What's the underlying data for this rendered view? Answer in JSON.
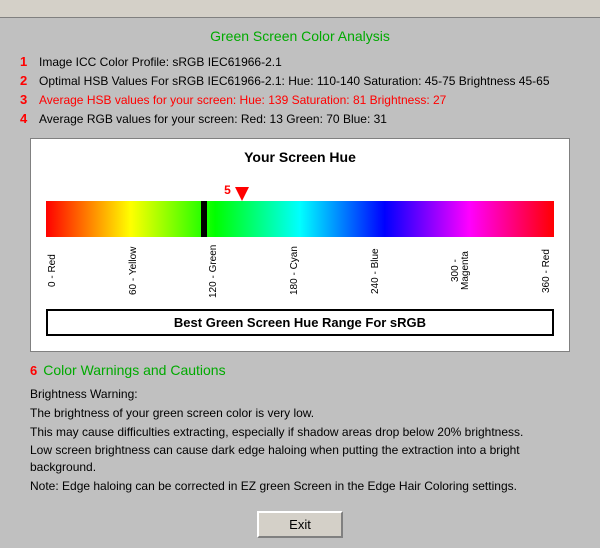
{
  "topBar": {},
  "title": "Green Screen Color Analysis",
  "infoRows": [
    {
      "id": 1,
      "bullet": "1",
      "label": "Image ICC Color Profile:",
      "value": " sRGB IEC61966-2.1",
      "highlighted": false
    },
    {
      "id": 2,
      "bullet": "2",
      "label": "Optimal HSB Values For sRGB IEC61966-2.1:",
      "value": " Hue: 110-140   Saturation: 45-75   Brightness 45-65",
      "highlighted": false
    },
    {
      "id": 3,
      "bullet": "3",
      "label": "Average HSB values for your screen:  Hue: 139  Saturation: 81  Brightness: 27",
      "value": "",
      "highlighted": true
    },
    {
      "id": 4,
      "bullet": "4",
      "label": "Average RGB values for your screen:  Red: 13  Green: 70  Blue: 31",
      "value": "",
      "highlighted": false
    }
  ],
  "huePanel": {
    "title": "Your Screen Hue",
    "indicatorLabel": "5",
    "indicatorPosition": 139,
    "hueMax": 360,
    "labels": [
      {
        "value": "0",
        "name": "Red"
      },
      {
        "value": "60",
        "name": "Yellow"
      },
      {
        "value": "120",
        "name": "Green"
      },
      {
        "value": "180",
        "name": "Cyan"
      },
      {
        "value": "240",
        "name": "Blue"
      },
      {
        "value": "300",
        "name": "Magenta"
      },
      {
        "value": "360",
        "name": "Red"
      }
    ],
    "greenRangeLabel": "Best Green Screen Hue Range For sRGB"
  },
  "warnings": {
    "sectionBullet": "6",
    "sectionTitle": "Color Warnings and Cautions",
    "lines": [
      "Brightness Warning:",
      "The brightness of your green screen color is very low.",
      "This may cause difficulties extracting, especially if shadow areas drop below 20% brightness.",
      "Low screen brightness can cause dark edge haloing when putting the extraction into a bright background.",
      "Note: Edge haloing can be corrected in EZ green Screen in the Edge Hair Coloring settings."
    ]
  },
  "exitButton": "Exit"
}
